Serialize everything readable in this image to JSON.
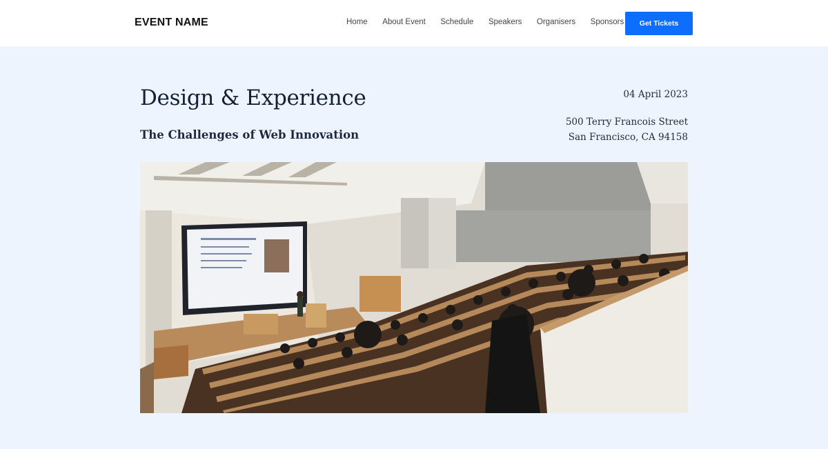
{
  "brand": "EVENT NAME",
  "nav": {
    "links": [
      "Home",
      "About Event",
      "Schedule",
      "Speakers",
      "Organisers",
      "Sponsors"
    ],
    "cta": "Get Tickets"
  },
  "hero": {
    "title": "Design & Experience",
    "subtitle": "The Challenges of Web Innovation",
    "date": "04 April 2023",
    "address_line1": "500 Terry Francois Street",
    "address_line2": "San Francisco, CA 94158"
  },
  "colors": {
    "accent": "#0d6efd",
    "page_background": "#eef4fd",
    "header_background": "#ffffff"
  },
  "image": {
    "subject": "lecture hall photo",
    "alt": ""
  }
}
